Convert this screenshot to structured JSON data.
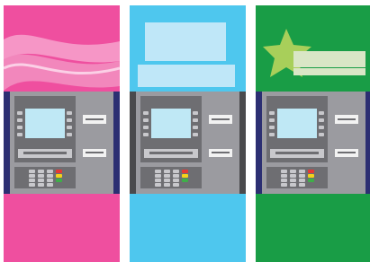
{
  "panels": [
    {
      "name": "pink",
      "background_color": "#ef4f9f",
      "accent_color": "#f7a2cd",
      "machine_side_color": "#2c2f72",
      "decoration": "waves"
    },
    {
      "name": "blue",
      "background_color": "#4ec7ee",
      "accent_color": "#bfe7f8",
      "machine_side_color": "#4a4a4c",
      "decoration": "rectangles"
    },
    {
      "name": "green",
      "background_color": "#199d46",
      "accent_color": "#a8cf5a",
      "machine_side_color": "#2c2f72",
      "decoration": "star"
    }
  ],
  "atm": {
    "body_color": "#9b9ba0",
    "frame_color": "#6e6e72",
    "screen_color": "#bfe8f5",
    "key_color": "#c8c8cc",
    "slot_color": "#f2f2f2",
    "green_key_color": "#3fae49",
    "yellow_key_color": "#f4d21a",
    "red_key_color": "#e53935"
  }
}
